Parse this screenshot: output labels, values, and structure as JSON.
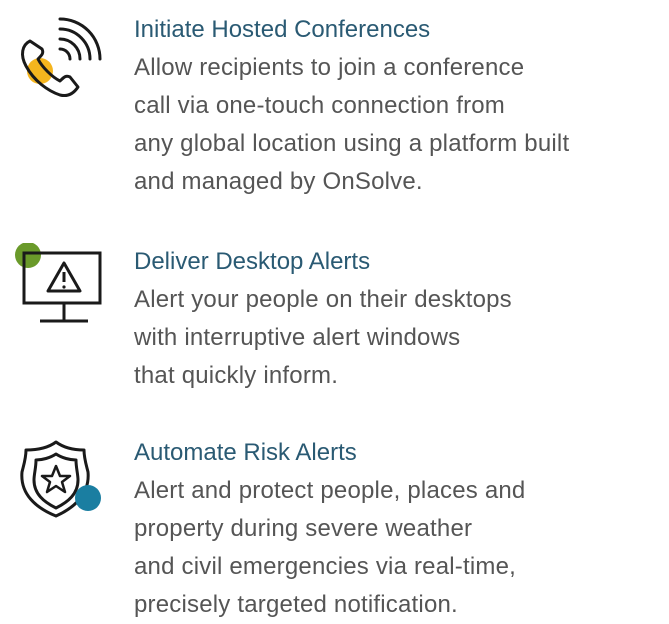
{
  "colors": {
    "title": "#2a5a73",
    "body": "#555555",
    "icon_stroke": "#1a1a1a",
    "accent_yellow": "#f5b51e",
    "accent_green": "#6a9a2a",
    "accent_blue": "#1a7ea1"
  },
  "features": [
    {
      "icon": "phone-call-icon",
      "title": "Initiate Hosted Conferences",
      "lines": [
        "Allow recipients to join a conference",
        "call via one-touch connection from",
        "any global location using a platform built",
        "and managed by OnSolve."
      ]
    },
    {
      "icon": "monitor-alert-icon",
      "title": "Deliver Desktop Alerts",
      "lines": [
        "Alert your people on their desktops",
        "with interruptive alert windows",
        "that quickly inform."
      ]
    },
    {
      "icon": "shield-star-icon",
      "title": "Automate Risk Alerts",
      "lines": [
        "Alert and protect people, places and",
        "property during severe weather",
        "and civil emergencies via real-time,",
        "precisely targeted notification."
      ]
    }
  ]
}
